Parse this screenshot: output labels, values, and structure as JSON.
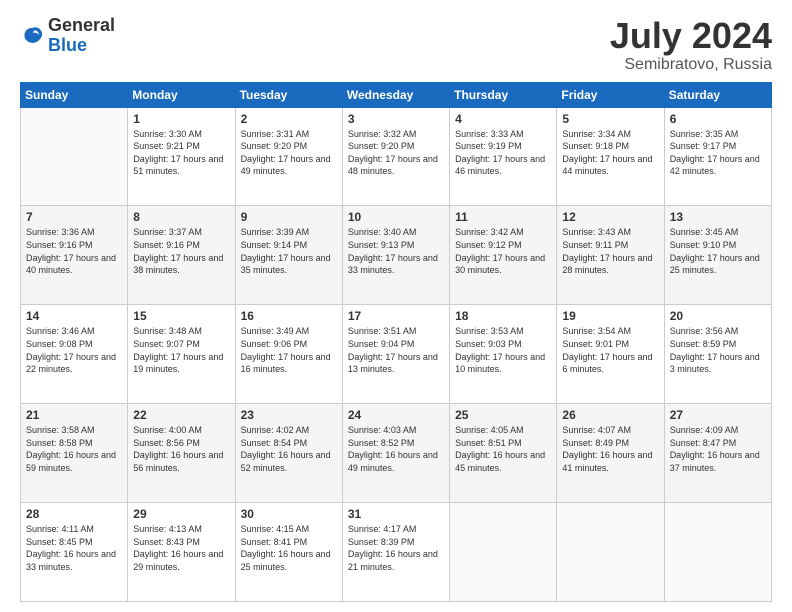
{
  "logo": {
    "general": "General",
    "blue": "Blue"
  },
  "title": "July 2024",
  "subtitle": "Semibratovo, Russia",
  "weekdays": [
    "Sunday",
    "Monday",
    "Tuesday",
    "Wednesday",
    "Thursday",
    "Friday",
    "Saturday"
  ],
  "weeks": [
    [
      {
        "day": "",
        "sunrise": "",
        "sunset": "",
        "daylight": ""
      },
      {
        "day": "1",
        "sunrise": "Sunrise: 3:30 AM",
        "sunset": "Sunset: 9:21 PM",
        "daylight": "Daylight: 17 hours and 51 minutes."
      },
      {
        "day": "2",
        "sunrise": "Sunrise: 3:31 AM",
        "sunset": "Sunset: 9:20 PM",
        "daylight": "Daylight: 17 hours and 49 minutes."
      },
      {
        "day": "3",
        "sunrise": "Sunrise: 3:32 AM",
        "sunset": "Sunset: 9:20 PM",
        "daylight": "Daylight: 17 hours and 48 minutes."
      },
      {
        "day": "4",
        "sunrise": "Sunrise: 3:33 AM",
        "sunset": "Sunset: 9:19 PM",
        "daylight": "Daylight: 17 hours and 46 minutes."
      },
      {
        "day": "5",
        "sunrise": "Sunrise: 3:34 AM",
        "sunset": "Sunset: 9:18 PM",
        "daylight": "Daylight: 17 hours and 44 minutes."
      },
      {
        "day": "6",
        "sunrise": "Sunrise: 3:35 AM",
        "sunset": "Sunset: 9:17 PM",
        "daylight": "Daylight: 17 hours and 42 minutes."
      }
    ],
    [
      {
        "day": "7",
        "sunrise": "Sunrise: 3:36 AM",
        "sunset": "Sunset: 9:16 PM",
        "daylight": "Daylight: 17 hours and 40 minutes."
      },
      {
        "day": "8",
        "sunrise": "Sunrise: 3:37 AM",
        "sunset": "Sunset: 9:16 PM",
        "daylight": "Daylight: 17 hours and 38 minutes."
      },
      {
        "day": "9",
        "sunrise": "Sunrise: 3:39 AM",
        "sunset": "Sunset: 9:14 PM",
        "daylight": "Daylight: 17 hours and 35 minutes."
      },
      {
        "day": "10",
        "sunrise": "Sunrise: 3:40 AM",
        "sunset": "Sunset: 9:13 PM",
        "daylight": "Daylight: 17 hours and 33 minutes."
      },
      {
        "day": "11",
        "sunrise": "Sunrise: 3:42 AM",
        "sunset": "Sunset: 9:12 PM",
        "daylight": "Daylight: 17 hours and 30 minutes."
      },
      {
        "day": "12",
        "sunrise": "Sunrise: 3:43 AM",
        "sunset": "Sunset: 9:11 PM",
        "daylight": "Daylight: 17 hours and 28 minutes."
      },
      {
        "day": "13",
        "sunrise": "Sunrise: 3:45 AM",
        "sunset": "Sunset: 9:10 PM",
        "daylight": "Daylight: 17 hours and 25 minutes."
      }
    ],
    [
      {
        "day": "14",
        "sunrise": "Sunrise: 3:46 AM",
        "sunset": "Sunset: 9:08 PM",
        "daylight": "Daylight: 17 hours and 22 minutes."
      },
      {
        "day": "15",
        "sunrise": "Sunrise: 3:48 AM",
        "sunset": "Sunset: 9:07 PM",
        "daylight": "Daylight: 17 hours and 19 minutes."
      },
      {
        "day": "16",
        "sunrise": "Sunrise: 3:49 AM",
        "sunset": "Sunset: 9:06 PM",
        "daylight": "Daylight: 17 hours and 16 minutes."
      },
      {
        "day": "17",
        "sunrise": "Sunrise: 3:51 AM",
        "sunset": "Sunset: 9:04 PM",
        "daylight": "Daylight: 17 hours and 13 minutes."
      },
      {
        "day": "18",
        "sunrise": "Sunrise: 3:53 AM",
        "sunset": "Sunset: 9:03 PM",
        "daylight": "Daylight: 17 hours and 10 minutes."
      },
      {
        "day": "19",
        "sunrise": "Sunrise: 3:54 AM",
        "sunset": "Sunset: 9:01 PM",
        "daylight": "Daylight: 17 hours and 6 minutes."
      },
      {
        "day": "20",
        "sunrise": "Sunrise: 3:56 AM",
        "sunset": "Sunset: 8:59 PM",
        "daylight": "Daylight: 17 hours and 3 minutes."
      }
    ],
    [
      {
        "day": "21",
        "sunrise": "Sunrise: 3:58 AM",
        "sunset": "Sunset: 8:58 PM",
        "daylight": "Daylight: 16 hours and 59 minutes."
      },
      {
        "day": "22",
        "sunrise": "Sunrise: 4:00 AM",
        "sunset": "Sunset: 8:56 PM",
        "daylight": "Daylight: 16 hours and 56 minutes."
      },
      {
        "day": "23",
        "sunrise": "Sunrise: 4:02 AM",
        "sunset": "Sunset: 8:54 PM",
        "daylight": "Daylight: 16 hours and 52 minutes."
      },
      {
        "day": "24",
        "sunrise": "Sunrise: 4:03 AM",
        "sunset": "Sunset: 8:52 PM",
        "daylight": "Daylight: 16 hours and 49 minutes."
      },
      {
        "day": "25",
        "sunrise": "Sunrise: 4:05 AM",
        "sunset": "Sunset: 8:51 PM",
        "daylight": "Daylight: 16 hours and 45 minutes."
      },
      {
        "day": "26",
        "sunrise": "Sunrise: 4:07 AM",
        "sunset": "Sunset: 8:49 PM",
        "daylight": "Daylight: 16 hours and 41 minutes."
      },
      {
        "day": "27",
        "sunrise": "Sunrise: 4:09 AM",
        "sunset": "Sunset: 8:47 PM",
        "daylight": "Daylight: 16 hours and 37 minutes."
      }
    ],
    [
      {
        "day": "28",
        "sunrise": "Sunrise: 4:11 AM",
        "sunset": "Sunset: 8:45 PM",
        "daylight": "Daylight: 16 hours and 33 minutes."
      },
      {
        "day": "29",
        "sunrise": "Sunrise: 4:13 AM",
        "sunset": "Sunset: 8:43 PM",
        "daylight": "Daylight: 16 hours and 29 minutes."
      },
      {
        "day": "30",
        "sunrise": "Sunrise: 4:15 AM",
        "sunset": "Sunset: 8:41 PM",
        "daylight": "Daylight: 16 hours and 25 minutes."
      },
      {
        "day": "31",
        "sunrise": "Sunrise: 4:17 AM",
        "sunset": "Sunset: 8:39 PM",
        "daylight": "Daylight: 16 hours and 21 minutes."
      },
      {
        "day": "",
        "sunrise": "",
        "sunset": "",
        "daylight": ""
      },
      {
        "day": "",
        "sunrise": "",
        "sunset": "",
        "daylight": ""
      },
      {
        "day": "",
        "sunrise": "",
        "sunset": "",
        "daylight": ""
      }
    ]
  ]
}
